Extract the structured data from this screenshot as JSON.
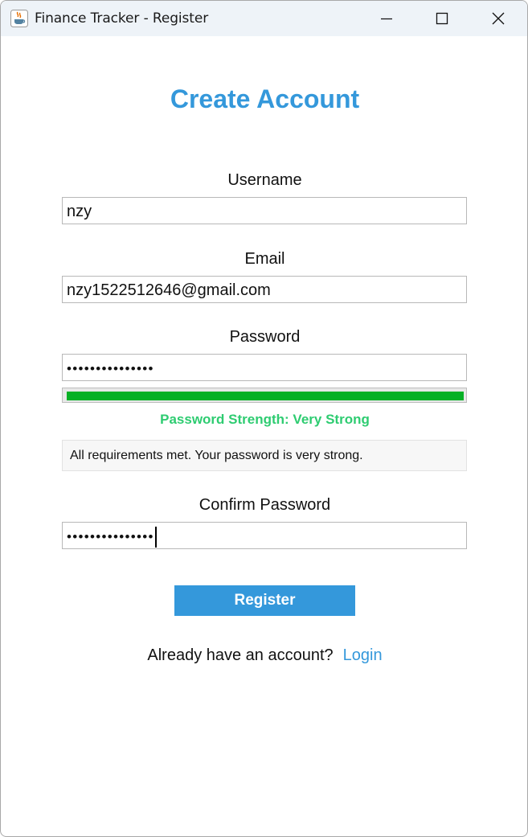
{
  "titlebar": {
    "title": "Finance Tracker - Register",
    "app_icon": "java-coffee-cup-icon",
    "controls": [
      "minimize-icon",
      "maximize-icon",
      "close-icon"
    ]
  },
  "form": {
    "heading": "Create Account",
    "username": {
      "label": "Username",
      "value": "nzy"
    },
    "email": {
      "label": "Email",
      "value": "nzy1522512646@gmail.com"
    },
    "password": {
      "label": "Password",
      "masked_value": "•••••••••••••••"
    },
    "strength": {
      "level": 1.0,
      "text": "Password Strength: Very Strong",
      "message": "All requirements met. Your password is very strong."
    },
    "confirm_password": {
      "label": "Confirm Password",
      "masked_value": "•••••••••••••••"
    },
    "register_label": "Register",
    "login_prompt": "Already have an account?",
    "login_link": "Login"
  },
  "colors": {
    "accent": "#3498db",
    "strength_bar": "#06b025",
    "strength_text": "#2ecc71"
  }
}
